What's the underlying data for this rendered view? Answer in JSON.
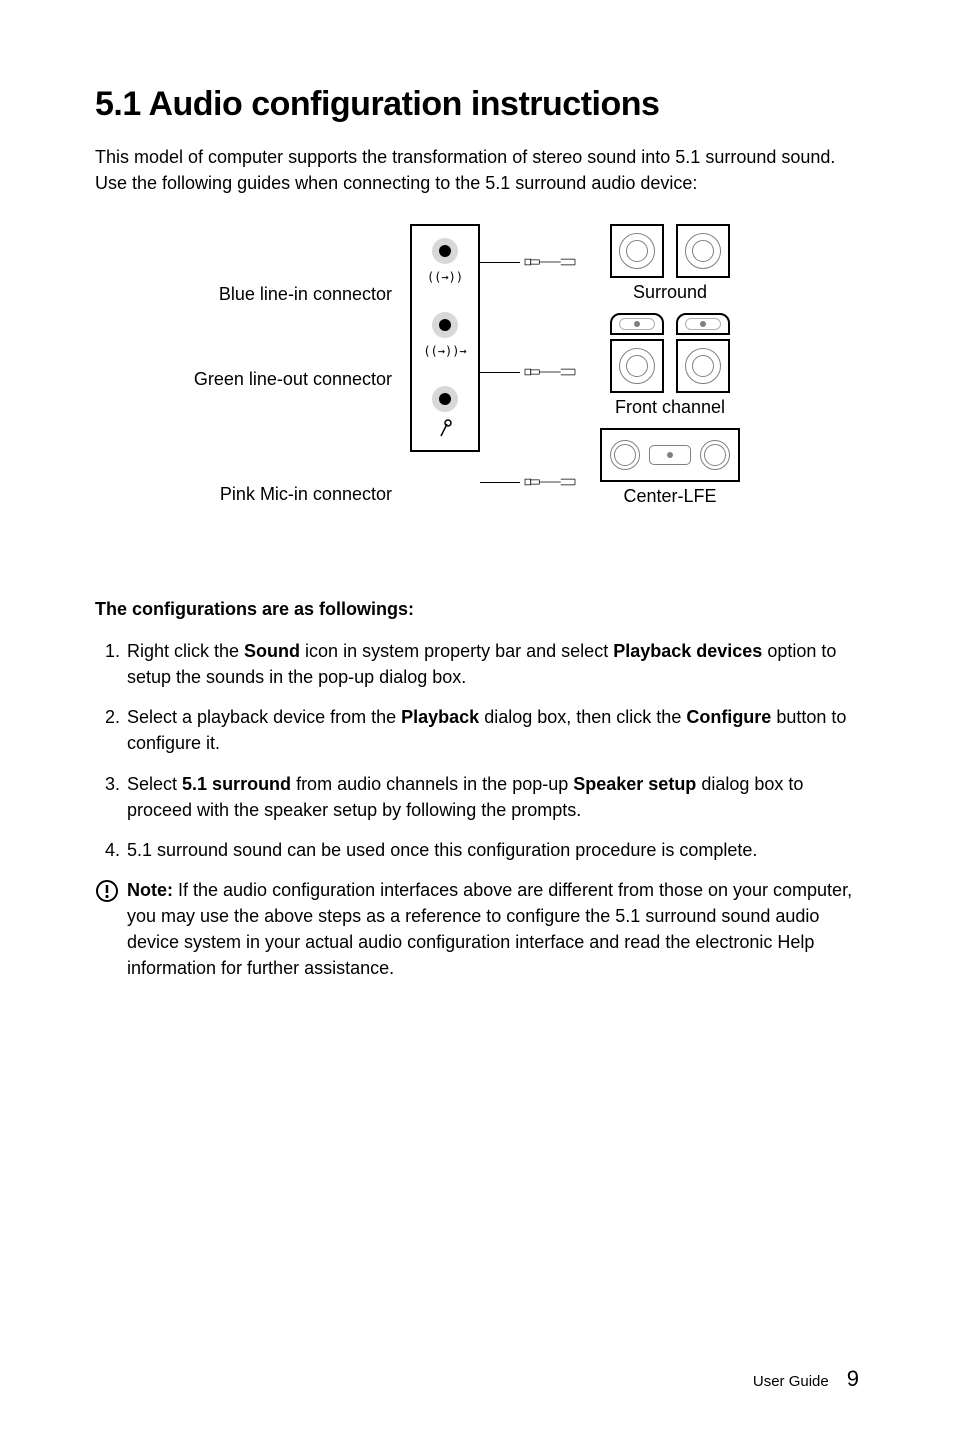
{
  "heading": "5.1 Audio configuration instructions",
  "intro_line1": "This model of computer supports the transformation of stereo sound into 5.1 surround sound.",
  "intro_line2": "Use the following guides when connecting to the 5.1 surround audio device:",
  "diagram": {
    "blue_label": "Blue line-in connector",
    "green_label": "Green line-out connector",
    "pink_label": "Pink Mic-in connector",
    "surround_label": "Surround",
    "front_label": "Front channel",
    "center_label": "Center-LFE"
  },
  "sub_heading": "The configurations are as followings:",
  "steps": {
    "s1_pre": "Right click the ",
    "s1_b1": "Sound",
    "s1_mid": " icon in system property bar and select ",
    "s1_b2": "Playback devices",
    "s1_post": " option to setup the sounds in the pop-up dialog box.",
    "s2_pre": "Select a playback device from the ",
    "s2_b1": "Playback",
    "s2_mid": " dialog box, then click the ",
    "s2_b2": "Configure",
    "s2_post": " button to configure it.",
    "s3_pre": "Select ",
    "s3_b1": "5.1 surround",
    "s3_mid": " from audio channels in the pop-up ",
    "s3_b2": "Speaker setup",
    "s3_post": " dialog box to proceed with the speaker setup by following the prompts.",
    "s4": "5.1 surround sound can be used once this configuration procedure is complete."
  },
  "note": {
    "label": "Note:",
    "text": " If the audio configuration interfaces above are different from those on your computer, you may use the above steps as a reference to configure the 5.1 surround sound audio device system in your actual audio configuration interface and read the electronic Help information for further assistance."
  },
  "footer": {
    "label": "User Guide",
    "page": "9"
  }
}
